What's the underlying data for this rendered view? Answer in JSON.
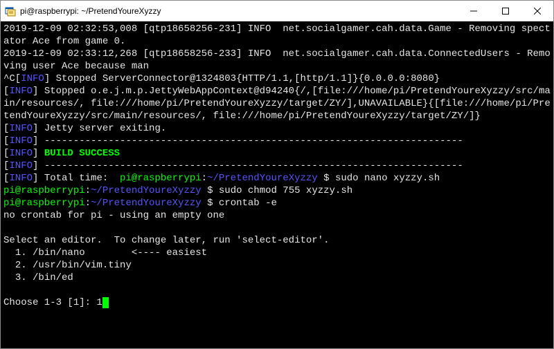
{
  "window": {
    "title": "pi@raspberrypi: ~/PretendYoureXyzzy"
  },
  "log": {
    "l1_ts": "2019-12-09 02:32:53,008 [qtp18658256-231] INFO  net.socialgamer.cah.data.Game - Removing spectator Ace from game 0.",
    "l2_ts": "2019-12-09 02:33:12,268 [qtp18658256-233] INFO  net.socialgamer.cah.data.ConnectedUsers - Removing user Ace because man",
    "l3_pre": "^C[",
    "l3_info": "INFO",
    "l3_rest": "] Stopped ServerConnector@1324803{HTTP/1.1,[http/1.1]}{0.0.0.0:8080}",
    "lb": "[",
    "rb": "] ",
    "info": "INFO",
    "jetty_stop": "Stopped o.e.j.m.p.JettyWebAppContext@d94240{/,[file:///home/pi/PretendYoureXyzzy/src/main/resources/, file:///home/pi/PretendYoureXyzzy/target/ZY/],UNAVAILABLE}{[file:///home/pi/PretendYoureXyzzy/src/main/resources/, file:///home/pi/PretendYoureXyzzy/target/ZY/]}",
    "jetty_exit": "Jetty server exiting.",
    "dashes": "------------------------------------------------------------------------",
    "build_success": "BUILD SUCCESS",
    "total_time": "Total time:  ",
    "prompt_user": "pi@raspberrypi",
    "prompt_colon": ":",
    "prompt_path": "~/PretendYoureXyzzy",
    "prompt_dollar": " $ ",
    "cmd1": "sudo nano xyzzy.sh",
    "cmd2": "sudo chmod 755 xyzzy.sh",
    "cmd3": "crontab -e",
    "no_crontab": "no crontab for pi - using an empty one",
    "blank": "",
    "select_editor": "Select an editor.  To change later, run 'select-editor'.",
    "opt1": "  1. /bin/nano        <---- easiest",
    "opt2": "  2. /usr/bin/vim.tiny",
    "opt3": "  3. /bin/ed",
    "choose": "Choose 1-3 [1]: ",
    "choose_input": "1"
  }
}
